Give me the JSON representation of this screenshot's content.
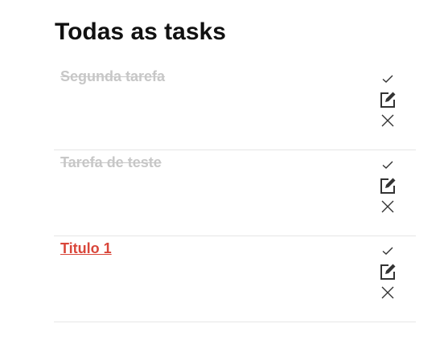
{
  "page": {
    "title": "Todas as tasks"
  },
  "tasks": [
    {
      "title": "Segunda tarefa",
      "status": "done"
    },
    {
      "title": "Tarefa de teste",
      "status": "done"
    },
    {
      "title": "Titulo 1",
      "status": "open"
    }
  ],
  "icons": {
    "complete": "check-icon",
    "edit": "edit-icon",
    "delete": "close-icon"
  },
  "colors": {
    "done_text": "#c7c7c7",
    "open_text": "#d9463a",
    "divider": "#e6e6e6",
    "icon": "#333333"
  }
}
